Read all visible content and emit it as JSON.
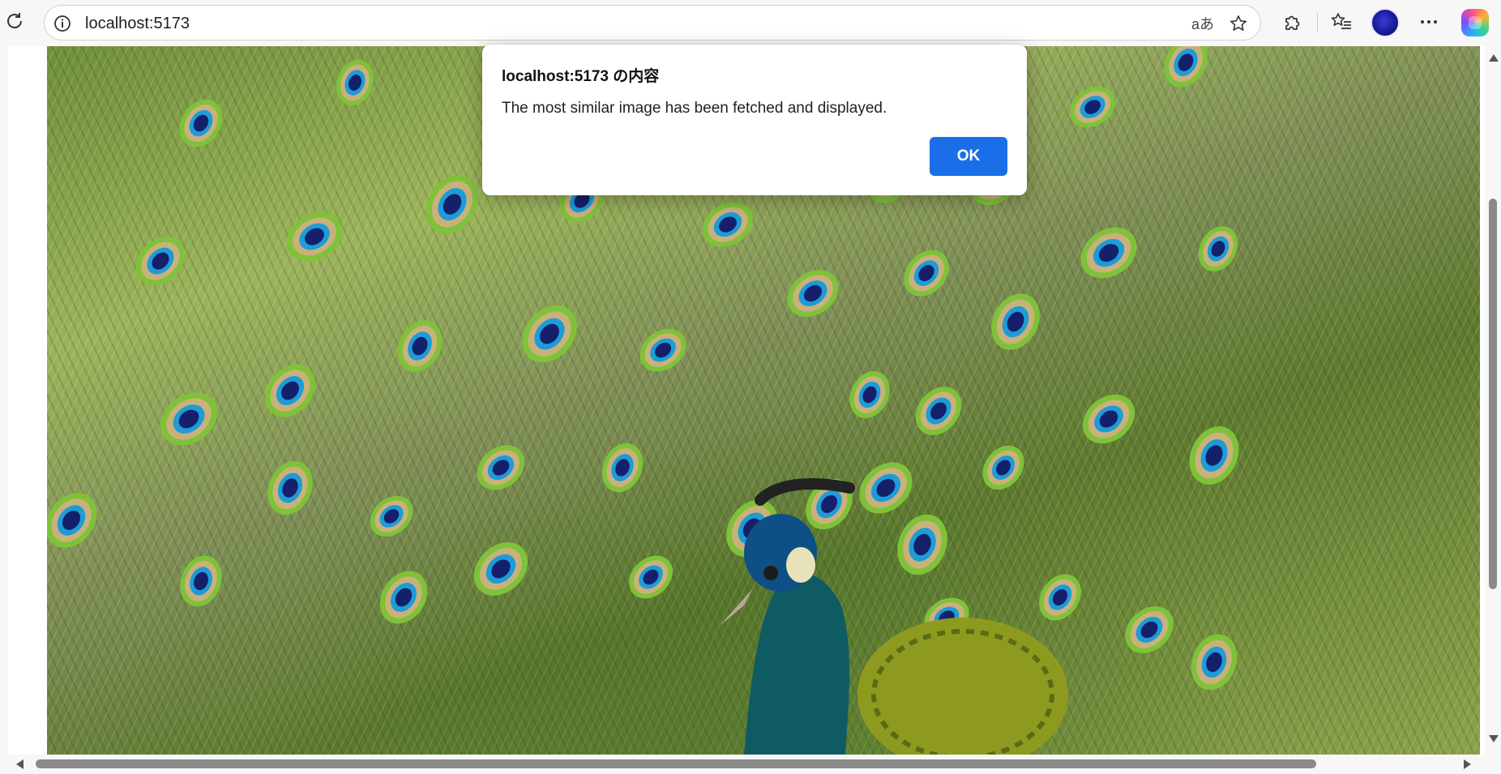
{
  "browser": {
    "url": "localhost:5173",
    "translate_glyph": "aあ"
  },
  "dialog": {
    "title": "localhost:5173 の内容",
    "message": "The most similar image has been fetched and displayed.",
    "ok_label": "OK"
  },
  "colors": {
    "ok_button": "#1a6fe8",
    "chrome_bg": "#f7f7f7"
  },
  "icons": {
    "reload": "reload-icon",
    "info": "info-icon",
    "favorite": "star-icon",
    "extensions": "puzzle-icon",
    "favorites_bar": "favorites-icon",
    "more": "more-icon"
  }
}
